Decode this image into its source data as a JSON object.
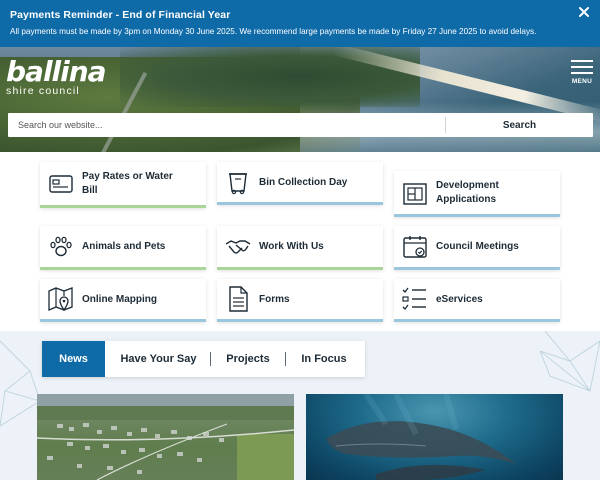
{
  "alert": {
    "title": "Payments Reminder - End of Financial Year",
    "text": "All payments must be made by 3pm on Monday 30 June 2025. We recommend large payments be made by Friday 27 June 2025 to avoid delays.",
    "close_icon": "close-icon"
  },
  "brand": {
    "name": "ballina",
    "subtitle": "shire council"
  },
  "menu": {
    "label": "MENU",
    "icon": "hamburger-icon"
  },
  "search": {
    "placeholder": "Search our website...",
    "button_label": "Search"
  },
  "quick_links": [
    {
      "label_line1": "Pay Rates or Water",
      "label_line2": "Bill",
      "icon": "payment-card-icon"
    },
    {
      "label_line1": "Bin Collection Day",
      "label_line2": "",
      "icon": "wheelie-bin-icon"
    },
    {
      "label_line1": "Development",
      "label_line2": "Applications",
      "icon": "building-plan-icon"
    },
    {
      "label_line1": "Animals and Pets",
      "label_line2": "",
      "icon": "paw-icon"
    },
    {
      "label_line1": "Work With Us",
      "label_line2": "",
      "icon": "handshake-icon"
    },
    {
      "label_line1": "Council Meetings",
      "label_line2": "",
      "icon": "calendar-check-icon"
    },
    {
      "label_line1": "Online Mapping",
      "label_line2": "",
      "icon": "map-pin-icon"
    },
    {
      "label_line1": "Forms",
      "label_line2": "",
      "icon": "document-icon"
    },
    {
      "label_line1": "eServices",
      "label_line2": "",
      "icon": "checklist-icon"
    }
  ],
  "tabs": [
    {
      "label": "News",
      "active": true
    },
    {
      "label": "Have Your Say",
      "active": false
    },
    {
      "label": "Projects",
      "active": false
    },
    {
      "label": "In Focus",
      "active": false
    }
  ],
  "colors": {
    "primary_blue": "#0f6aa8",
    "tile_accent": "#9bc7de",
    "section_bg": "#ecf2f7"
  }
}
